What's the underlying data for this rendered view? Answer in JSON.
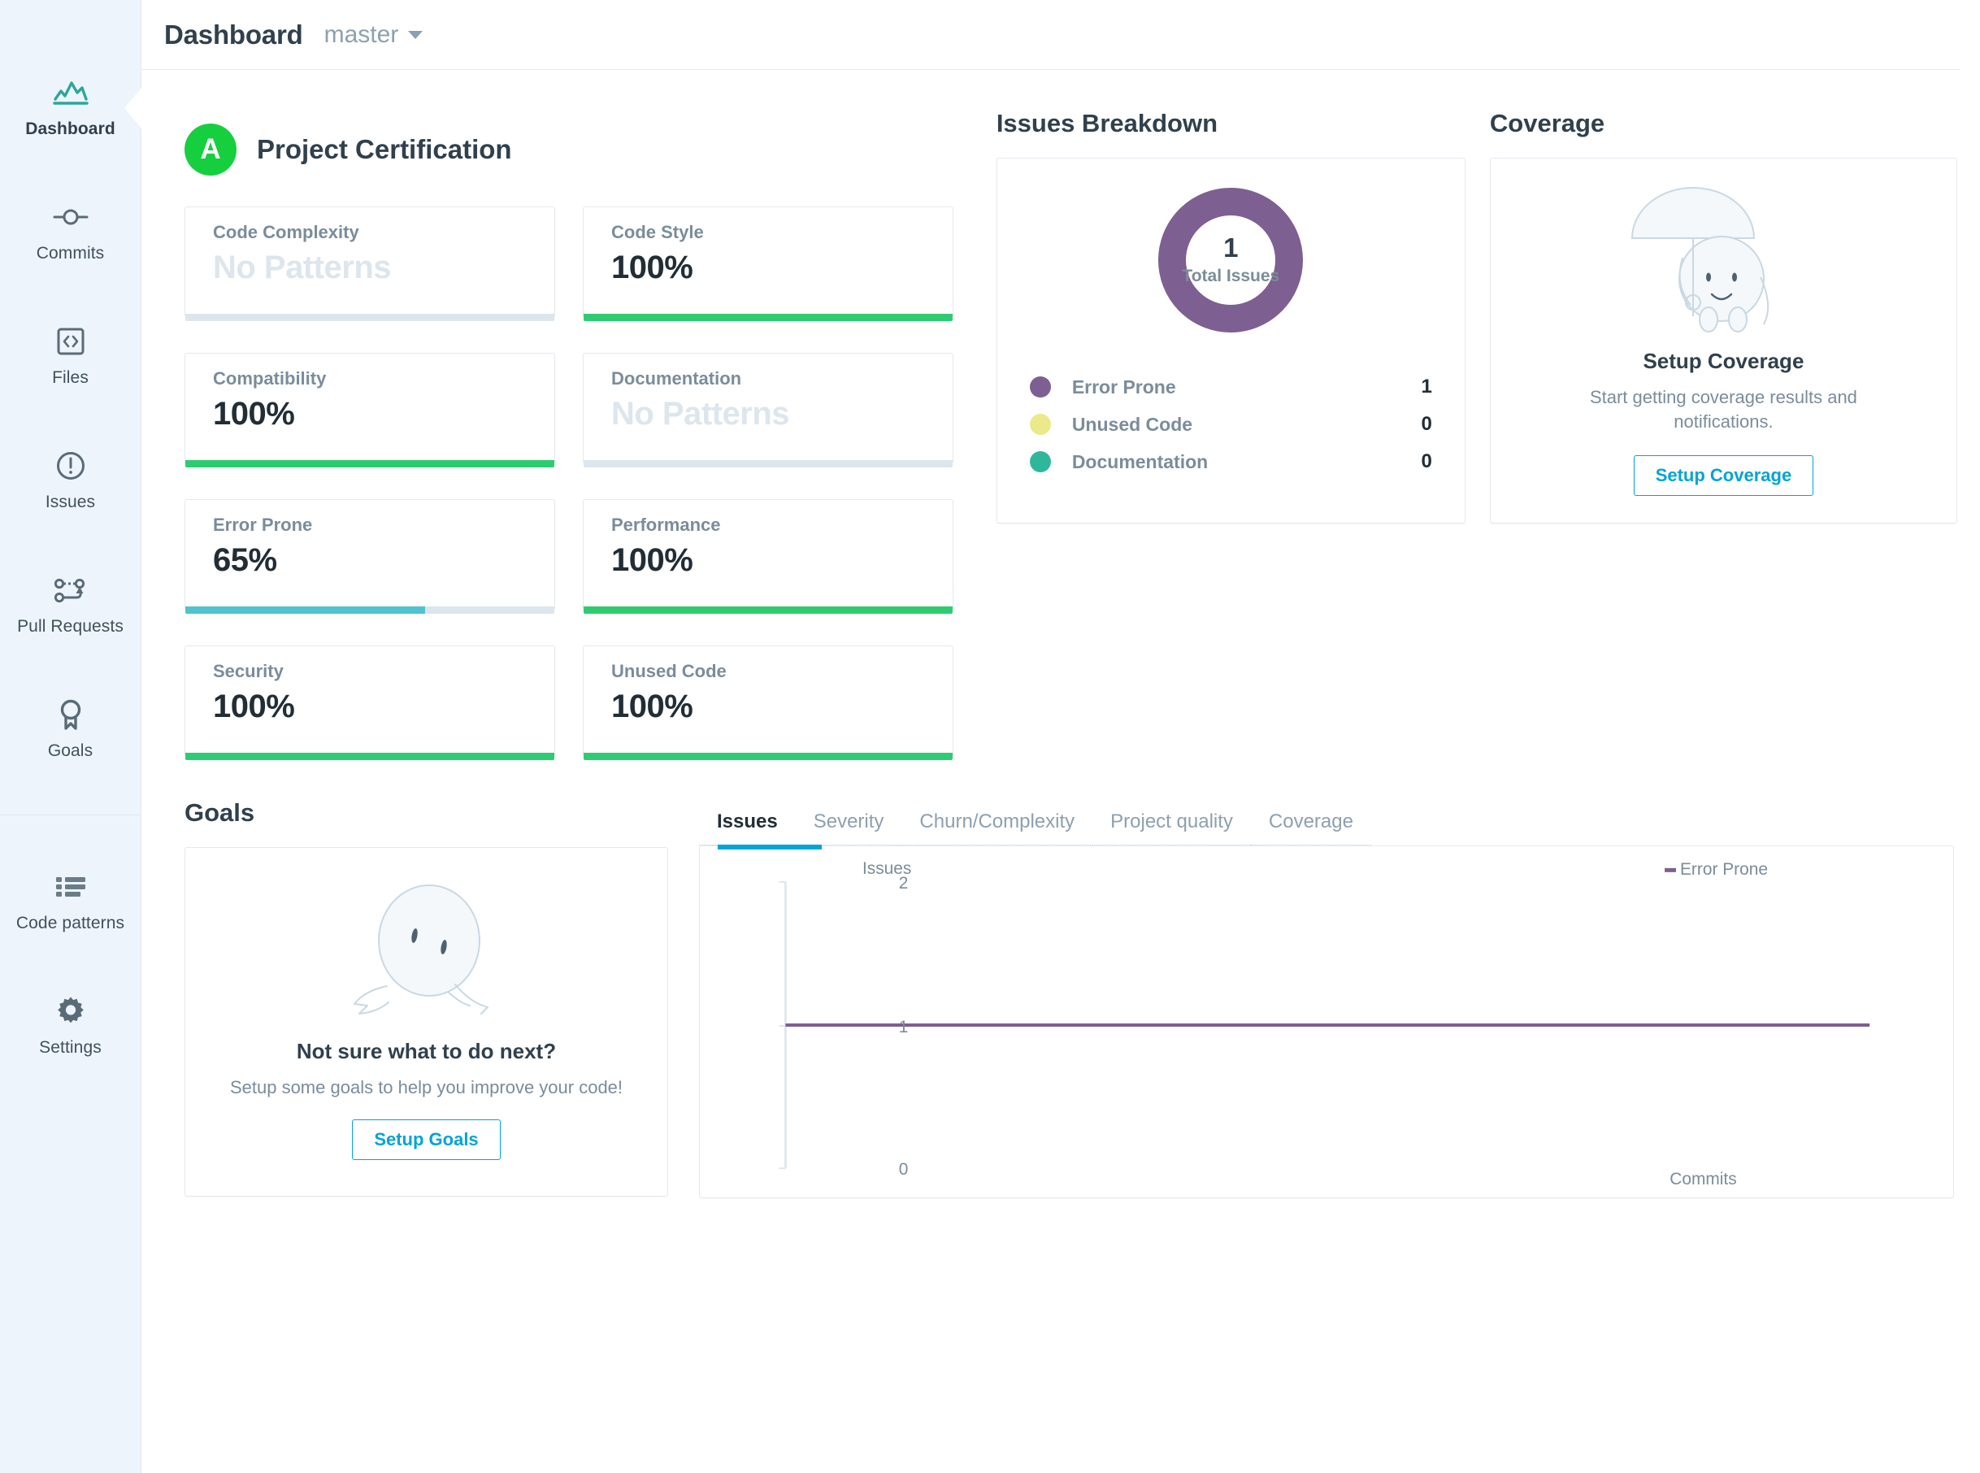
{
  "sidebar": {
    "items": [
      {
        "label": "Dashboard",
        "icon": "chart-line-icon",
        "active": true
      },
      {
        "label": "Commits",
        "icon": "commit-icon",
        "active": false
      },
      {
        "label": "Files",
        "icon": "code-file-icon",
        "active": false
      },
      {
        "label": "Issues",
        "icon": "alert-circle-icon",
        "active": false
      },
      {
        "label": "Pull Requests",
        "icon": "pull-request-icon",
        "active": false
      },
      {
        "label": "Goals",
        "icon": "medal-icon",
        "active": false
      },
      {
        "label": "Code patterns",
        "icon": "list-icon",
        "active": false
      },
      {
        "label": "Settings",
        "icon": "gear-icon",
        "active": false
      }
    ]
  },
  "header": {
    "title": "Dashboard",
    "branch": "master"
  },
  "certification": {
    "title": "Project Certification",
    "grade": "A",
    "grade_color": "#16cf3e",
    "metrics": [
      {
        "label": "Code Complexity",
        "value": "No Patterns",
        "percent": 0,
        "empty": true,
        "color": "#dde5ed"
      },
      {
        "label": "Code Style",
        "value": "100%",
        "percent": 100,
        "empty": false,
        "color": "#2ecc71"
      },
      {
        "label": "Compatibility",
        "value": "100%",
        "percent": 100,
        "empty": false,
        "color": "#2ecc71"
      },
      {
        "label": "Documentation",
        "value": "No Patterns",
        "percent": 0,
        "empty": true,
        "color": "#dde5ed"
      },
      {
        "label": "Error Prone",
        "value": "65%",
        "percent": 65,
        "empty": false,
        "color": "#4fc3cf"
      },
      {
        "label": "Performance",
        "value": "100%",
        "percent": 100,
        "empty": false,
        "color": "#2ecc71"
      },
      {
        "label": "Security",
        "value": "100%",
        "percent": 100,
        "empty": false,
        "color": "#2ecc71"
      },
      {
        "label": "Unused Code",
        "value": "100%",
        "percent": 100,
        "empty": false,
        "color": "#2ecc71"
      }
    ]
  },
  "issues_breakdown": {
    "title": "Issues Breakdown",
    "total": "1",
    "total_caption": "Total Issues",
    "donut_color": "#7d5f92",
    "legend": [
      {
        "name": "Error Prone",
        "value": "1",
        "color": "#7d5f92"
      },
      {
        "name": "Unused Code",
        "value": "0",
        "color": "#ece98a"
      },
      {
        "name": "Documentation",
        "value": "0",
        "color": "#2fb79b"
      }
    ]
  },
  "coverage": {
    "title": "Coverage",
    "empty_title": "Setup Coverage",
    "empty_desc": "Start getting coverage results and notifications.",
    "button": "Setup Coverage",
    "art": "umbrella-mascot-icon"
  },
  "goals": {
    "title": "Goals",
    "empty_title": "Not sure what to do next?",
    "empty_desc": "Setup some goals to help you improve your code!",
    "button": "Setup Goals",
    "art": "running-mascot-icon"
  },
  "chart_tabs": [
    {
      "label": "Issues",
      "active": true
    },
    {
      "label": "Severity",
      "active": false
    },
    {
      "label": "Churn/Complexity",
      "active": false
    },
    {
      "label": "Project quality",
      "active": false
    },
    {
      "label": "Coverage",
      "active": false
    }
  ],
  "chart_data": {
    "type": "line",
    "title": "",
    "xlabel": "Commits",
    "ylabel": "Issues",
    "ylim": [
      0,
      2
    ],
    "yticks": [
      "0",
      "1",
      "2"
    ],
    "grid": false,
    "legend_position": "top-right",
    "series": [
      {
        "name": "Error Prone",
        "color": "#7d5f92",
        "values": [
          1,
          1
        ]
      }
    ],
    "x": [
      0,
      1
    ]
  },
  "accent": {
    "cyan": "#00a4d6",
    "green": "#2ecc71",
    "purple": "#7d5f92"
  }
}
